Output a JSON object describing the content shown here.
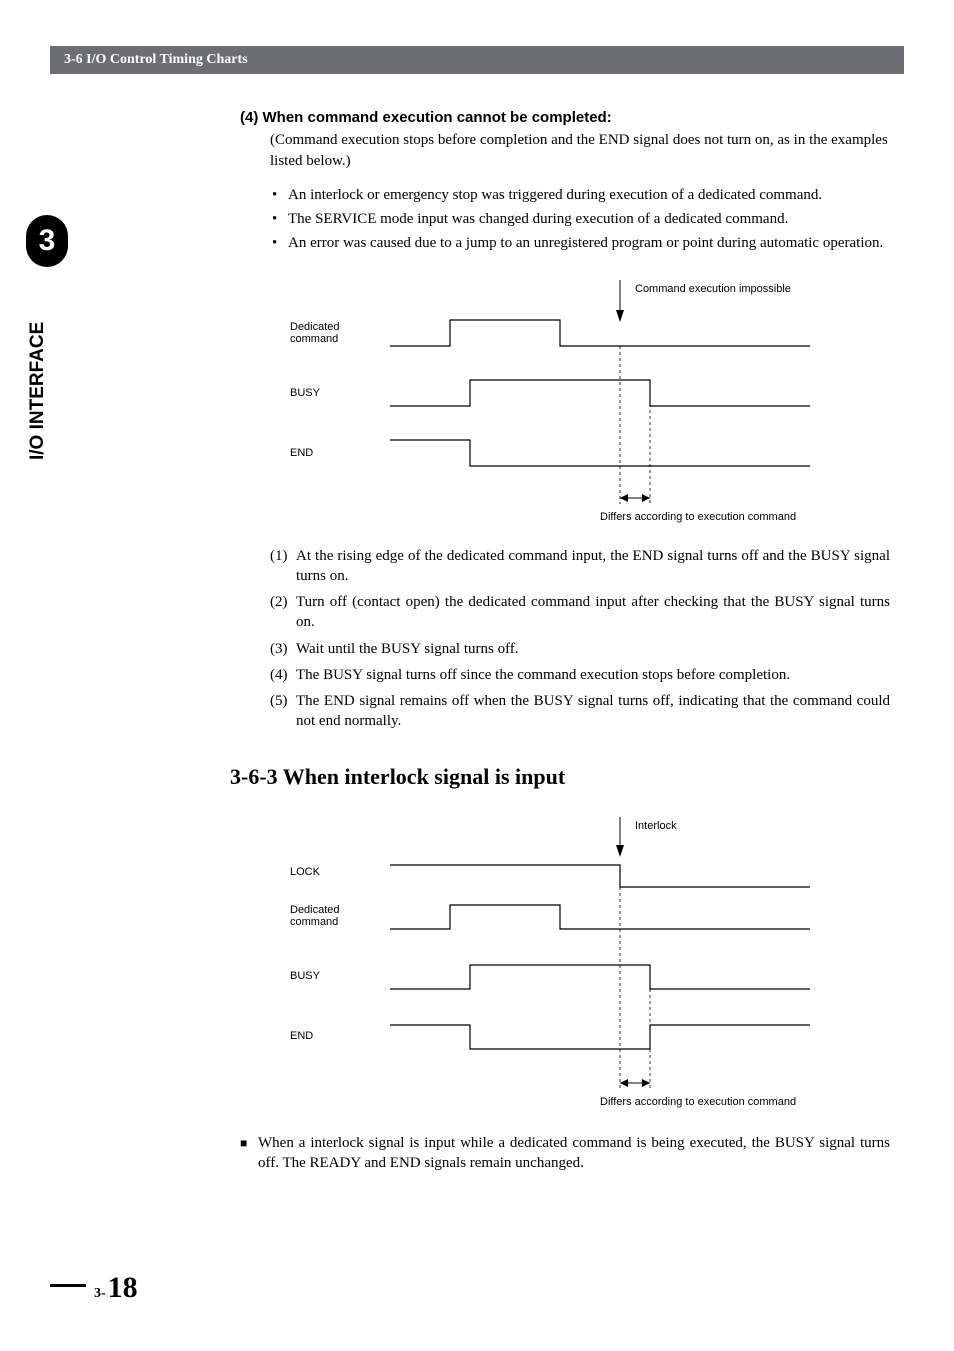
{
  "header": {
    "title": "3-6 I/O Control Timing Charts"
  },
  "chapter": {
    "number": "3",
    "sideLabel": "I/O INTERFACE"
  },
  "section4": {
    "title": "(4) When command execution cannot be completed:",
    "intro": "(Command execution stops before completion and the END signal does not turn on, as in the examples listed below.)",
    "bullets": [
      "An interlock or emergency stop was triggered during execution of a dedicated command.",
      "The SERVICE mode input was changed during execution of a dedicated command.",
      "An error was caused due to a jump to an unregistered program or point during automatic operation."
    ],
    "diagram": {
      "labels": {
        "topArrow": "Command execution impossible",
        "dedicated": "Dedicated\ncommand",
        "busy": "BUSY",
        "end": "END",
        "bottomNote": "Differs according to execution command"
      }
    },
    "steps": [
      {
        "n": "(1)",
        "t": "At the rising edge of the dedicated command input, the END signal turns off and the BUSY signal turns on."
      },
      {
        "n": "(2)",
        "t": "Turn off (contact open) the dedicated command input after checking that the BUSY signal turns on."
      },
      {
        "n": "(3)",
        "t": "Wait until the BUSY signal turns off."
      },
      {
        "n": "(4)",
        "t": "The BUSY signal turns off since the command execution stops before completion."
      },
      {
        "n": "(5)",
        "t": "The END signal remains off when the BUSY signal turns off, indicating that the command could not end normally."
      }
    ]
  },
  "section363": {
    "heading": "3-6-3  When interlock signal is input",
    "diagram": {
      "labels": {
        "topArrow": "Interlock",
        "lock": "LOCK",
        "dedicated": "Dedicated\ncommand",
        "busy": "BUSY",
        "end": "END",
        "bottomNote": "Differs according to execution command"
      }
    },
    "note": "When a interlock signal is input while a dedicated command is being executed, the BUSY signal turns off. The READY and END signals remain unchanged."
  },
  "footer": {
    "prefix": "3-",
    "page": "18"
  },
  "chart_data": [
    {
      "type": "timing",
      "title": "Command execution impossible",
      "signals": [
        {
          "name": "Dedicated command",
          "levels": "low→high→low",
          "event": "falls before completion"
        },
        {
          "name": "BUSY",
          "levels": "low→high→low",
          "event": "turns off when execution stops"
        },
        {
          "name": "END",
          "levels": "high→low (stays low)",
          "event": "remains off"
        }
      ],
      "annotation": "Differs according to execution command"
    },
    {
      "type": "timing",
      "title": "Interlock",
      "signals": [
        {
          "name": "LOCK",
          "levels": "high→low",
          "event": "interlock asserted"
        },
        {
          "name": "Dedicated command",
          "levels": "low→high→low"
        },
        {
          "name": "BUSY",
          "levels": "low→high→low",
          "event": "turns off on interlock"
        },
        {
          "name": "END",
          "levels": "high→low→high",
          "event": "remains unchanged (pulse shown)"
        }
      ],
      "annotation": "Differs according to execution command"
    }
  ]
}
